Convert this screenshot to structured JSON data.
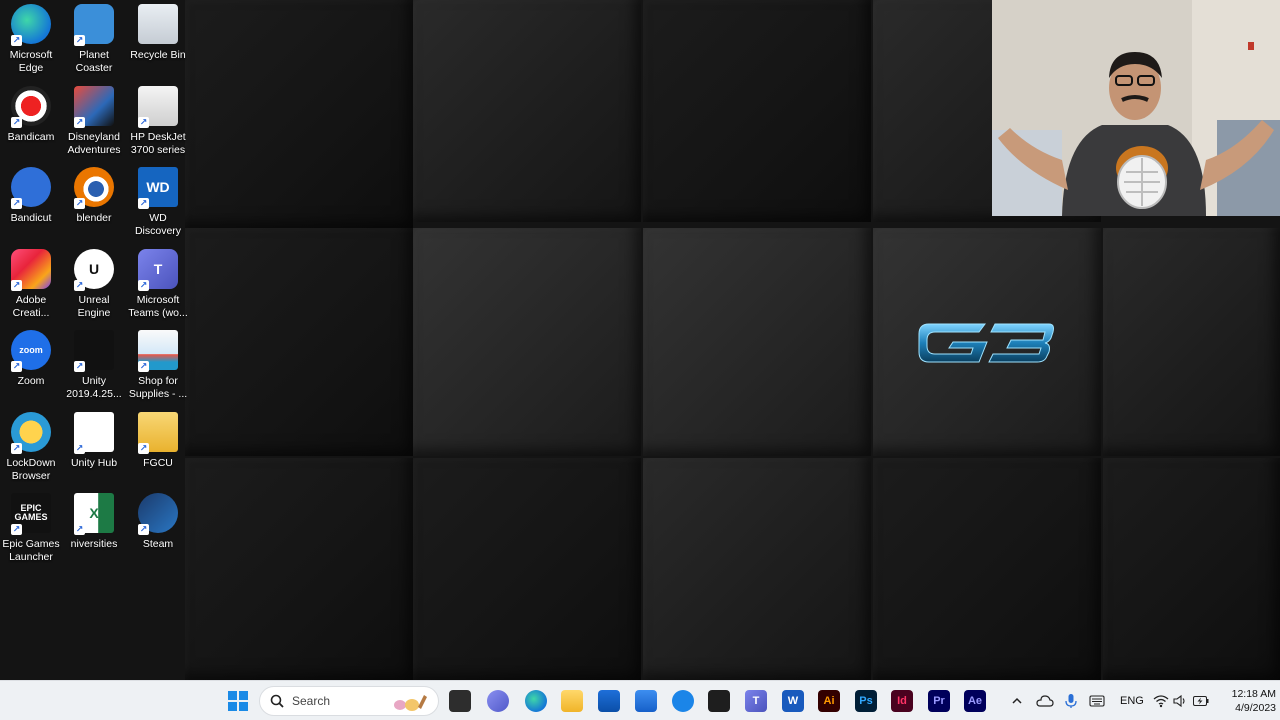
{
  "desktop_icons": [
    {
      "label": "Microsoft\nEdge",
      "icon": "edge-icon"
    },
    {
      "label": "Planet\nCoaster",
      "icon": "planet-coaster-icon"
    },
    {
      "label": "Recycle Bin",
      "icon": "recycle-bin-icon"
    },
    {
      "label": "Bandicam",
      "icon": "bandicam-icon"
    },
    {
      "label": "Disneyland\nAdventures",
      "icon": "disneyland-icon"
    },
    {
      "label": "HP DeskJet\n3700 series",
      "icon": "printer-icon"
    },
    {
      "label": "Bandicut",
      "icon": "bandicut-icon"
    },
    {
      "label": "blender",
      "icon": "blender-icon"
    },
    {
      "label": "WD\nDiscovery",
      "icon": "wd-icon",
      "glyph": "WD"
    },
    {
      "label": "Adobe\nCreati...",
      "icon": "adobe-cc-icon"
    },
    {
      "label": "Unreal\nEngine",
      "icon": "unreal-icon",
      "glyph": "U"
    },
    {
      "label": "Microsoft\nTeams (wo...",
      "icon": "teams-icon",
      "glyph": "T"
    },
    {
      "label": "Zoom",
      "icon": "zoom-icon",
      "glyph": "zoom"
    },
    {
      "label": "Unity\n2019.4.25...",
      "icon": "unity-icon"
    },
    {
      "label": "Shop for\nSupplies - ...",
      "icon": "shop-supplies-icon"
    },
    {
      "label": "LockDown\nBrowser",
      "icon": "lockdown-icon"
    },
    {
      "label": "Unity Hub",
      "icon": "unity-hub-icon"
    },
    {
      "label": "FGCU",
      "icon": "folder-icon"
    },
    {
      "label": "Epic Games\nLauncher",
      "icon": "epic-games-icon",
      "glyph": "EPIC\nGAMES"
    },
    {
      "label": "niversities",
      "icon": "excel-icon",
      "glyph": "X"
    },
    {
      "label": "Steam",
      "icon": "steam-icon"
    }
  ],
  "wallpaper": {
    "logo_text": "G3",
    "accent": "#2a9fd6"
  },
  "taskbar": {
    "search_placeholder": "Search",
    "apps": [
      {
        "icon": "task-view-icon"
      },
      {
        "icon": "teams-chat-icon"
      },
      {
        "icon": "edge-icon"
      },
      {
        "icon": "file-explorer-icon"
      },
      {
        "icon": "store-icon"
      },
      {
        "icon": "mail-icon"
      },
      {
        "icon": "snipping-icon"
      },
      {
        "icon": "terminal-icon"
      },
      {
        "icon": "teams-icon",
        "glyph": "T"
      },
      {
        "icon": "word-icon",
        "glyph": "W"
      },
      {
        "icon": "illustrator-icon",
        "glyph": "Ai"
      },
      {
        "icon": "photoshop-icon",
        "glyph": "Ps"
      },
      {
        "icon": "indesign-icon",
        "glyph": "Id"
      },
      {
        "icon": "premiere-icon",
        "glyph": "Pr"
      },
      {
        "icon": "after-effects-icon",
        "glyph": "Ae"
      }
    ],
    "tray": {
      "language": "ENG",
      "time": "12:18 AM",
      "date": "4/9/2023"
    }
  }
}
